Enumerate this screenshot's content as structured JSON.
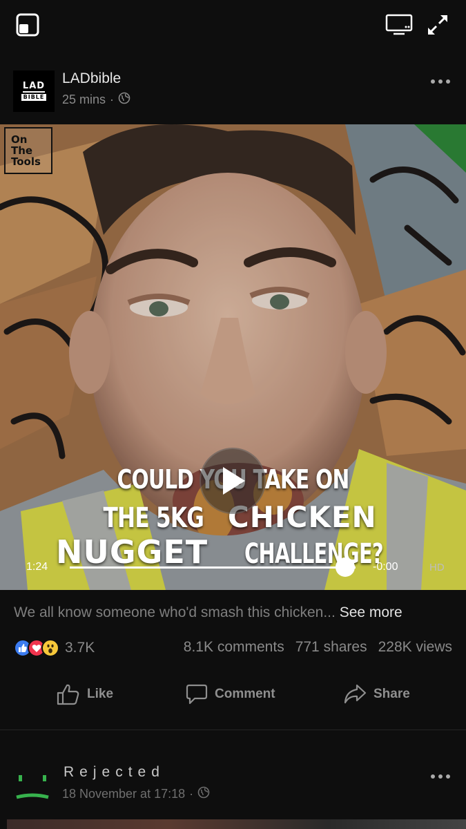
{
  "topbar": {
    "icons": [
      "picture-in-picture-icon",
      "cast-icon",
      "fullscreen-icon"
    ]
  },
  "post": {
    "author": "LADbible",
    "avatar_text_top": "LAD",
    "avatar_text_bottom": "BIBLE",
    "time": "25 mins",
    "dot": "·",
    "video": {
      "corner_badge": "On\nThe\nTools",
      "caption_line1": "COULD YOU TAKE ON",
      "caption_line2_thin": "THE 5KG",
      "caption_line2_big": "CHICKEN",
      "caption_line3_big": "NUGGET",
      "caption_line3_thin": "CHALLENGE?",
      "current_time": "1:24",
      "remaining_time": "-0:00",
      "quality": "HD",
      "progress": 0.94
    },
    "description": "We all know someone who'd smash this chicken...",
    "see_more": "See more",
    "reactions_count": "3.7K",
    "comments": "8.1K comments",
    "shares": "771 shares",
    "views": "228K views",
    "actions": {
      "like": "Like",
      "comment": "Comment",
      "share": "Share"
    }
  },
  "post2": {
    "author": "Rejected",
    "time": "18 November at 17:18",
    "dot": "·"
  },
  "colors": {
    "background": "#0e0e0e",
    "like_blue": "#3c7cf0",
    "love_red": "#f0344e",
    "wow_yellow": "#f7c83a",
    "rejected_green": "#37b24d"
  }
}
